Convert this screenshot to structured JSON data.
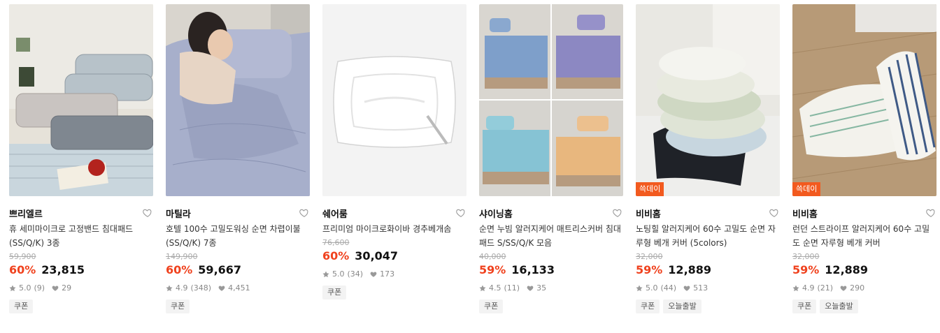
{
  "products": [
    {
      "brand": "쁘리엘르",
      "title": "휴 세미마이크로 고정밴드 침대패드 (SS/Q/K) 3종",
      "original_price": "59,900",
      "discount": "60%",
      "price": "23,815",
      "rating": "5.0",
      "reviews": "(9)",
      "likes": "29",
      "badge": "",
      "tags": [
        "쿠폰"
      ],
      "colors": {
        "bg": "#e9ece8",
        "item": "#a9b4bd",
        "accent": "#cfd6da"
      }
    },
    {
      "brand": "마틸라",
      "title": "호텔 100수 고밀도워싱 순면 차렵이불(SS/Q/K) 7종",
      "original_price": "149,900",
      "discount": "60%",
      "price": "59,667",
      "rating": "4.9",
      "reviews": "(348)",
      "likes": "4,451",
      "badge": "",
      "tags": [
        "쿠폰"
      ],
      "colors": {
        "bg": "#d8d5cf",
        "item": "#9aa3c2",
        "accent": "#bfc4d8"
      }
    },
    {
      "brand": "쉐어룸",
      "title": "프리미엄 마이크로화이바 경추베개솜",
      "original_price": "76,600",
      "discount": "60%",
      "price": "30,047",
      "rating": "5.0",
      "reviews": "(34)",
      "likes": "173",
      "badge": "",
      "tags": [
        "쿠폰"
      ],
      "colors": {
        "bg": "#f4f4f4",
        "item": "#ffffff",
        "accent": "#e3e3e3"
      }
    },
    {
      "brand": "샤이닝홈",
      "title": "순면 누빔 알러지케어 매트리스커버 침대패드 S/SS/Q/K 모음",
      "original_price": "40,000",
      "discount": "59%",
      "price": "16,133",
      "rating": "4.5",
      "reviews": "(11)",
      "likes": "35",
      "badge": "",
      "tags": [
        "쿠폰"
      ],
      "colors": {
        "bg": "#d7d5cf",
        "item": "#7e9fc9",
        "accent": "#8d88c0"
      }
    },
    {
      "brand": "비비홈",
      "title": "노팅힐 알러지케어 60수 고밀도 순면 자루형 베개 커버 (5colors)",
      "original_price": "32,000",
      "discount": "59%",
      "price": "12,889",
      "rating": "5.0",
      "reviews": "(44)",
      "likes": "513",
      "badge": "쓱데이",
      "tags": [
        "쿠폰",
        "오늘출발"
      ],
      "colors": {
        "bg": "#e7e6e1",
        "item": "#f1f1ee",
        "accent": "#c8d3c0"
      }
    },
    {
      "brand": "비비홈",
      "title": "런던 스트라이프 알러지케어 60수 고밀도 순면 자루형 베개 커버",
      "original_price": "32,000",
      "discount": "59%",
      "price": "12,889",
      "rating": "4.9",
      "reviews": "(21)",
      "likes": "290",
      "badge": "쓱데이",
      "tags": [
        "쿠폰",
        "오늘출발"
      ],
      "colors": {
        "bg": "#b79a77",
        "item": "#f2f1ec",
        "accent": "#3f5a86"
      }
    }
  ]
}
